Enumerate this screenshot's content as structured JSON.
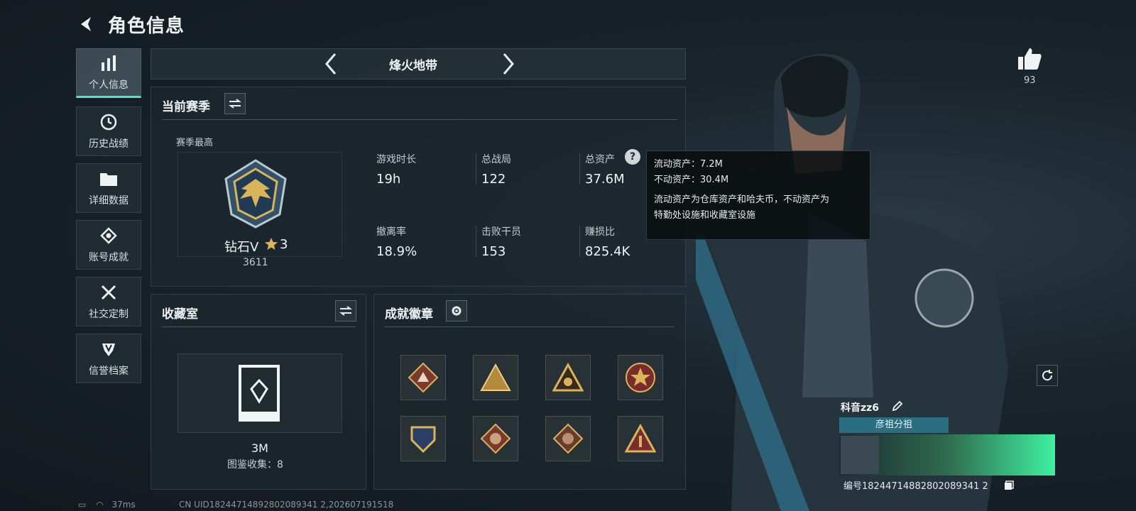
{
  "header": {
    "title": "角色信息"
  },
  "sidebar": {
    "items": [
      {
        "label": "个人信息",
        "icon": "bar-chart-icon",
        "active": true
      },
      {
        "label": "历史战绩",
        "icon": "clock-icon"
      },
      {
        "label": "详细数据",
        "icon": "folder-icon"
      },
      {
        "label": "账号成就",
        "icon": "achievement-icon"
      },
      {
        "label": "社交定制",
        "icon": "tools-icon"
      },
      {
        "label": "信誉档案",
        "icon": "shield-badge-icon"
      }
    ]
  },
  "mode": {
    "label": "烽火地带"
  },
  "season": {
    "title": "当前赛季",
    "best_label": "赛季最高",
    "rank_name": "钻石V",
    "rank_stars": "3",
    "rank_score": "3611",
    "stats": [
      {
        "label": "游戏时长",
        "value": "19h"
      },
      {
        "label": "总战局",
        "value": "122"
      },
      {
        "label": "总资产",
        "value": "37.6M"
      },
      {
        "label": "撤离率",
        "value": "18.9%"
      },
      {
        "label": "击败干员",
        "value": "153"
      },
      {
        "label": "赚损比",
        "value": "825.4K"
      }
    ]
  },
  "tooltip": {
    "line1": "流动资产：7.2M",
    "line2": "不动资产：30.4M",
    "desc1": "流动资产为仓库资产和哈夫币，不动资产为",
    "desc2": "特勤处设施和收藏室设施"
  },
  "collection": {
    "title": "收藏室",
    "value": "3M",
    "count_text": "图鉴收集：8"
  },
  "badges": {
    "title": "成就徽章"
  },
  "like": {
    "count": "93"
  },
  "player": {
    "name": "科音zz6",
    "group": "彦祖分祖",
    "id_text": "编号18244714882802089341 2"
  },
  "footer": {
    "ping": "37ms",
    "uid": "CN UID18244714892802089341 2,202607191518"
  },
  "colors": {
    "accent": "#4ee4c6",
    "panel": "#1c262e",
    "gold": "#d9b45a"
  }
}
